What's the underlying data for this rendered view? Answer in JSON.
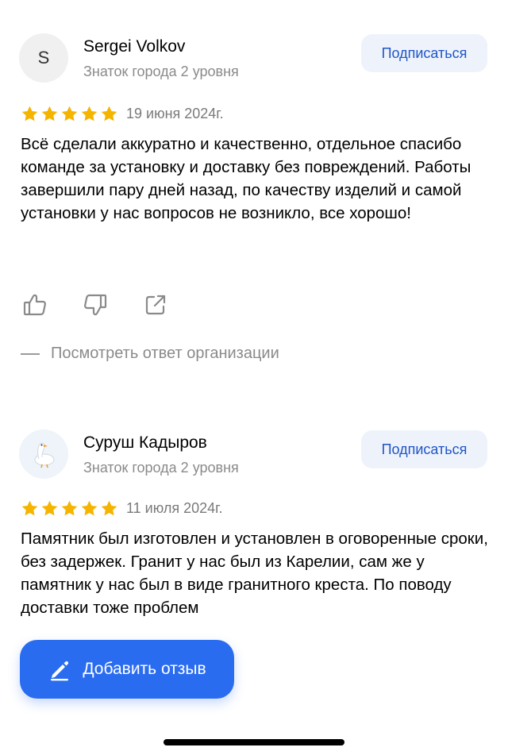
{
  "reviews": [
    {
      "avatar_letter": "S",
      "author": "Sergei Volkov",
      "badge": "Знаток города 2 уровня",
      "subscribe_label": "Подписаться",
      "rating": 5,
      "date": "19 июня 2024г.",
      "text": "Всё сделали аккуратно и качественно, отдельное спасибо команде за установку и доставку без повреждений. Работы завершили пару дней назад, по качеству изделий и самой установки у нас вопросов не возникло, все хорошо!",
      "org_reply_label": "Посмотреть ответ организации"
    },
    {
      "avatar_icon": "goose-icon",
      "author": "Суруш Кадыров",
      "badge": "Знаток города 2 уровня",
      "subscribe_label": "Подписаться",
      "rating": 5,
      "date": "11 июля 2024г.",
      "text": "Памятник был изготовлен и установлен в оговоренные сроки, без задержек. Гранит у нас был из Карелии, сам же у памятник у нас был в виде гранитного креста. По поводу доставки тоже проблем"
    }
  ],
  "add_review_label": "Добавить отзыв",
  "colors": {
    "accent": "#2a6cf0",
    "subscribe_text": "#1f55c7",
    "star": "#f5b400"
  }
}
